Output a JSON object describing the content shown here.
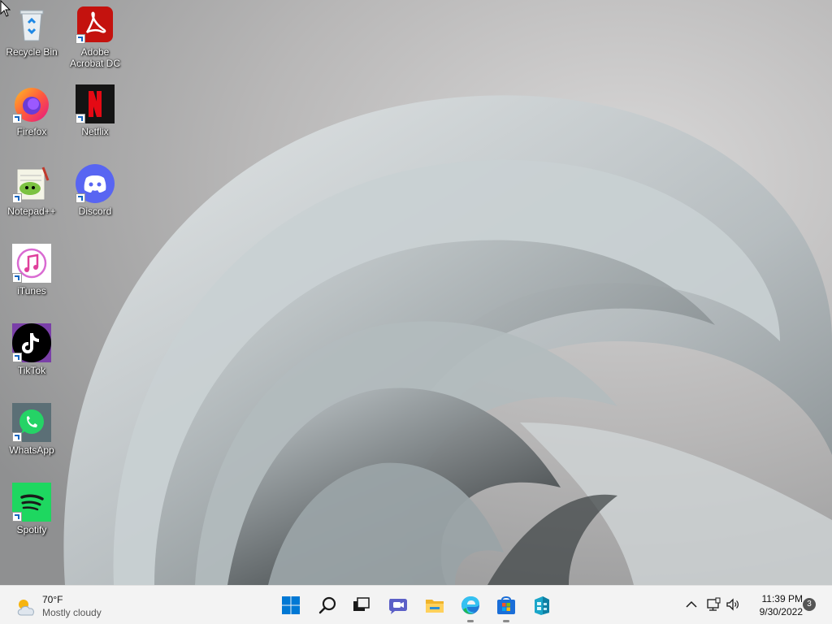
{
  "desktop_icons": [
    {
      "label": "Recycle Bin",
      "icon": "recycle-bin-icon"
    },
    {
      "label": "Adobe Acrobat DC",
      "icon": "adobe-acrobat-icon"
    },
    {
      "label": "Firefox",
      "icon": "firefox-icon"
    },
    {
      "label": "Netflix",
      "icon": "netflix-icon"
    },
    {
      "label": "Notepad++",
      "icon": "notepad-plus-plus-icon"
    },
    {
      "label": "Discord",
      "icon": "discord-icon"
    },
    {
      "label": "iTunes",
      "icon": "itunes-icon"
    },
    {
      "label": "TikTok",
      "icon": "tiktok-icon"
    },
    {
      "label": "WhatsApp",
      "icon": "whatsapp-icon"
    },
    {
      "label": "Spotify",
      "icon": "spotify-icon"
    }
  ],
  "taskbar": {
    "weather": {
      "temp": "70°F",
      "condition": "Mostly cloudy",
      "icon": "partly-cloudy-icon"
    },
    "pinned": [
      "windows-start-icon",
      "search-icon",
      "task-view-icon",
      "chat-icon",
      "file-explorer-icon",
      "edge-icon",
      "microsoft-store-icon",
      "azure-data-studio-icon"
    ],
    "clock": {
      "time": "11:39 PM",
      "date": "9/30/2022"
    },
    "notification_count": "3"
  },
  "colors": {
    "taskbar_bg": "#f3f3f3",
    "accent": "#0078d4"
  }
}
